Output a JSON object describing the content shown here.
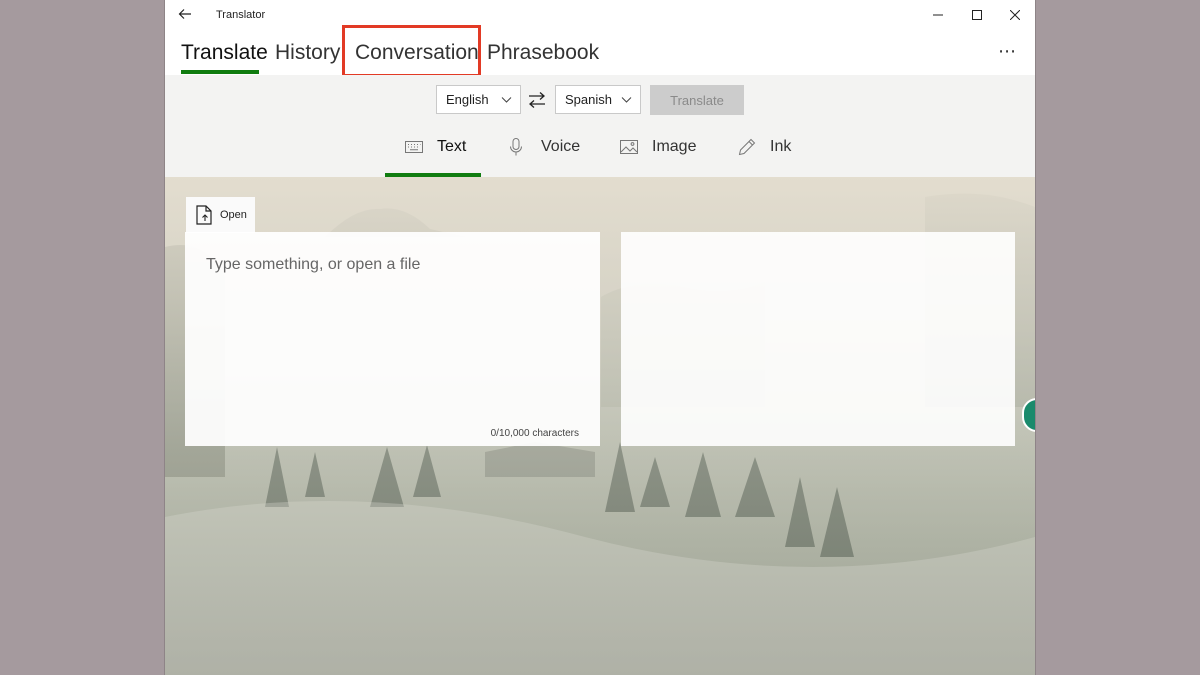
{
  "window": {
    "title": "Translator"
  },
  "pivot": {
    "tabs": [
      {
        "label": "Translate"
      },
      {
        "label": "History"
      },
      {
        "label": "Conversation"
      },
      {
        "label": "Phrasebook"
      }
    ],
    "active": "Translate",
    "highlighted": "Conversation"
  },
  "languages": {
    "from": "English",
    "to": "Spanish"
  },
  "translate_button": "Translate",
  "modes": [
    {
      "label": "Text",
      "icon": "keyboard-icon"
    },
    {
      "label": "Voice",
      "icon": "microphone-icon"
    },
    {
      "label": "Image",
      "icon": "image-icon"
    },
    {
      "label": "Ink",
      "icon": "pen-icon"
    }
  ],
  "active_mode": "Text",
  "open_button": "Open",
  "source": {
    "placeholder": "Type something, or open a file",
    "count": "0/10,000 characters"
  },
  "colors": {
    "accent": "#107c10",
    "highlight": "#e23a25",
    "disabled": "#cccccc"
  }
}
